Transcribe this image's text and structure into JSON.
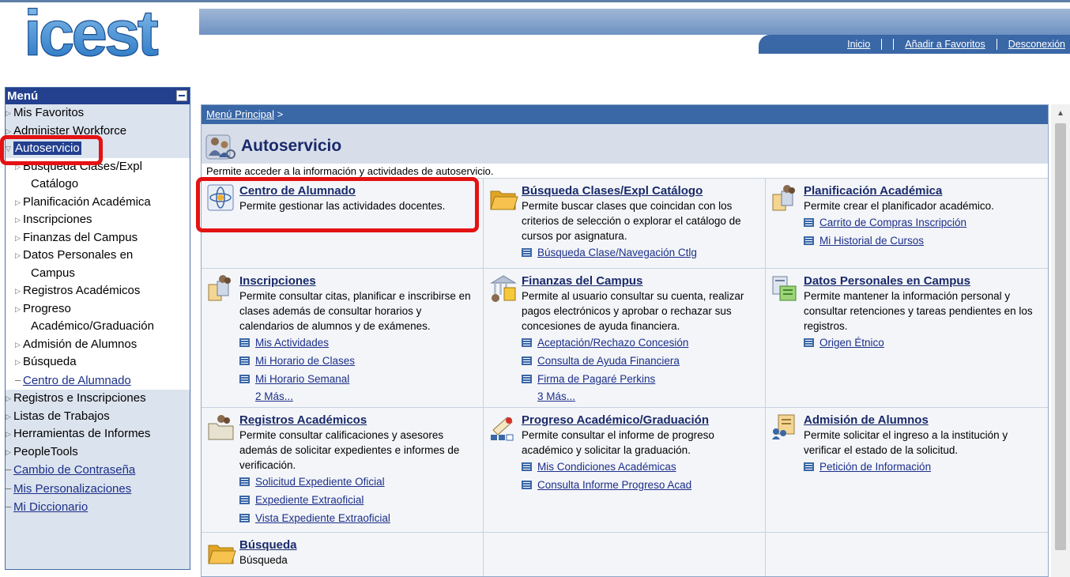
{
  "header": {
    "logo_text": "icest",
    "nav": [
      "Inicio",
      "Añadir a Favoritos",
      "Desconexión"
    ]
  },
  "menu": {
    "title": "Menú",
    "items": [
      {
        "label": "Mis Favoritos"
      },
      {
        "label": "Administer Workforce"
      },
      {
        "label": "Autoservicio"
      }
    ],
    "sub_items": [
      {
        "label": "Búsqueda Clases/Expl",
        "cont": "Catálogo"
      },
      {
        "label": "Planificación Académica"
      },
      {
        "label": "Inscripciones"
      },
      {
        "label": "Finanzas del Campus"
      },
      {
        "label": "Datos Personales en",
        "cont": "Campus"
      },
      {
        "label": "Registros Académicos"
      },
      {
        "label": "Progreso",
        "cont": "Académico/Graduación"
      },
      {
        "label": "Admisión de Alumnos"
      },
      {
        "label": "Búsqueda"
      },
      {
        "label": "Centro de Alumnado"
      }
    ],
    "after_items": [
      {
        "label": "Registros e Inscripciones"
      },
      {
        "label": "Listas de Trabajos"
      },
      {
        "label": "Herramientas de Informes"
      },
      {
        "label": "PeopleTools"
      },
      {
        "label": "Cambio de Contraseña"
      },
      {
        "label": "Mis Personalizaciones"
      },
      {
        "label": "Mi Diccionario"
      }
    ]
  },
  "breadcrumb": {
    "link": "Menú Principal",
    "sep": " >"
  },
  "page": {
    "title": "Autoservicio",
    "description": "Permite acceder a la información y actividades de autoservicio."
  },
  "cells": [
    {
      "title": "Centro de Alumnado",
      "desc": "Permite gestionar las actividades docentes.",
      "links": [],
      "more": ""
    },
    {
      "title": "Búsqueda Clases/Expl Catálogo",
      "desc": "Permite buscar clases que coincidan con los criterios de selección o explorar el catálogo de cursos por asignatura.",
      "links": [
        "Búsqueda Clase/Navegación Ctlg"
      ],
      "more": ""
    },
    {
      "title": "Planificación Académica",
      "desc": "Permite crear el planificador académico.",
      "links": [
        "Carrito de Compras Inscripción",
        "Mi Historial de Cursos"
      ],
      "more": ""
    },
    {
      "title": "Inscripciones",
      "desc": "Permite consultar citas, planificar e inscribirse en clases además de consultar horarios y calendarios de alumnos y de exámenes.",
      "links": [
        "Mis Actividades",
        "Mi Horario de Clases",
        "Mi Horario Semanal"
      ],
      "more": "2 Más..."
    },
    {
      "title": "Finanzas del Campus",
      "desc": "Permite al usuario consultar su cuenta, realizar pagos electrónicos y aprobar o rechazar sus concesiones de ayuda financiera.",
      "links": [
        "Aceptación/Rechazo Concesión",
        "Consulta de Ayuda Financiera",
        "Firma de Pagaré Perkins"
      ],
      "more": "3 Más..."
    },
    {
      "title": "Datos Personales en Campus",
      "desc": "Permite mantener la información personal y consultar retenciones y tareas pendientes en los registros.",
      "links": [
        "Origen Étnico"
      ],
      "more": ""
    },
    {
      "title": "Registros Académicos",
      "desc": "Permite consultar calificaciones y asesores además de solicitar expedientes e informes de verificación.",
      "links": [
        "Solicitud Expediente Oficial",
        "Expediente Extraoficial",
        "Vista Expediente Extraoficial"
      ],
      "more": ""
    },
    {
      "title": "Progreso Académico/Graduación",
      "desc": "Permite consultar el informe de progreso académico y solicitar la graduación.",
      "links": [
        "Mis Condiciones Académicas",
        "Consulta Informe Progreso Acad"
      ],
      "more": ""
    },
    {
      "title": "Admisión de Alumnos",
      "desc": "Permite solicitar el ingreso a la institución y verificar el estado de la solicitud.",
      "links": [
        "Petición de Información"
      ],
      "more": ""
    },
    {
      "title": "Búsqueda",
      "desc": "Búsqueda",
      "links": [],
      "more": ""
    }
  ],
  "colors": {
    "accent": "#23408f",
    "highlight": "#e41212",
    "link": "#1c2f8a"
  }
}
